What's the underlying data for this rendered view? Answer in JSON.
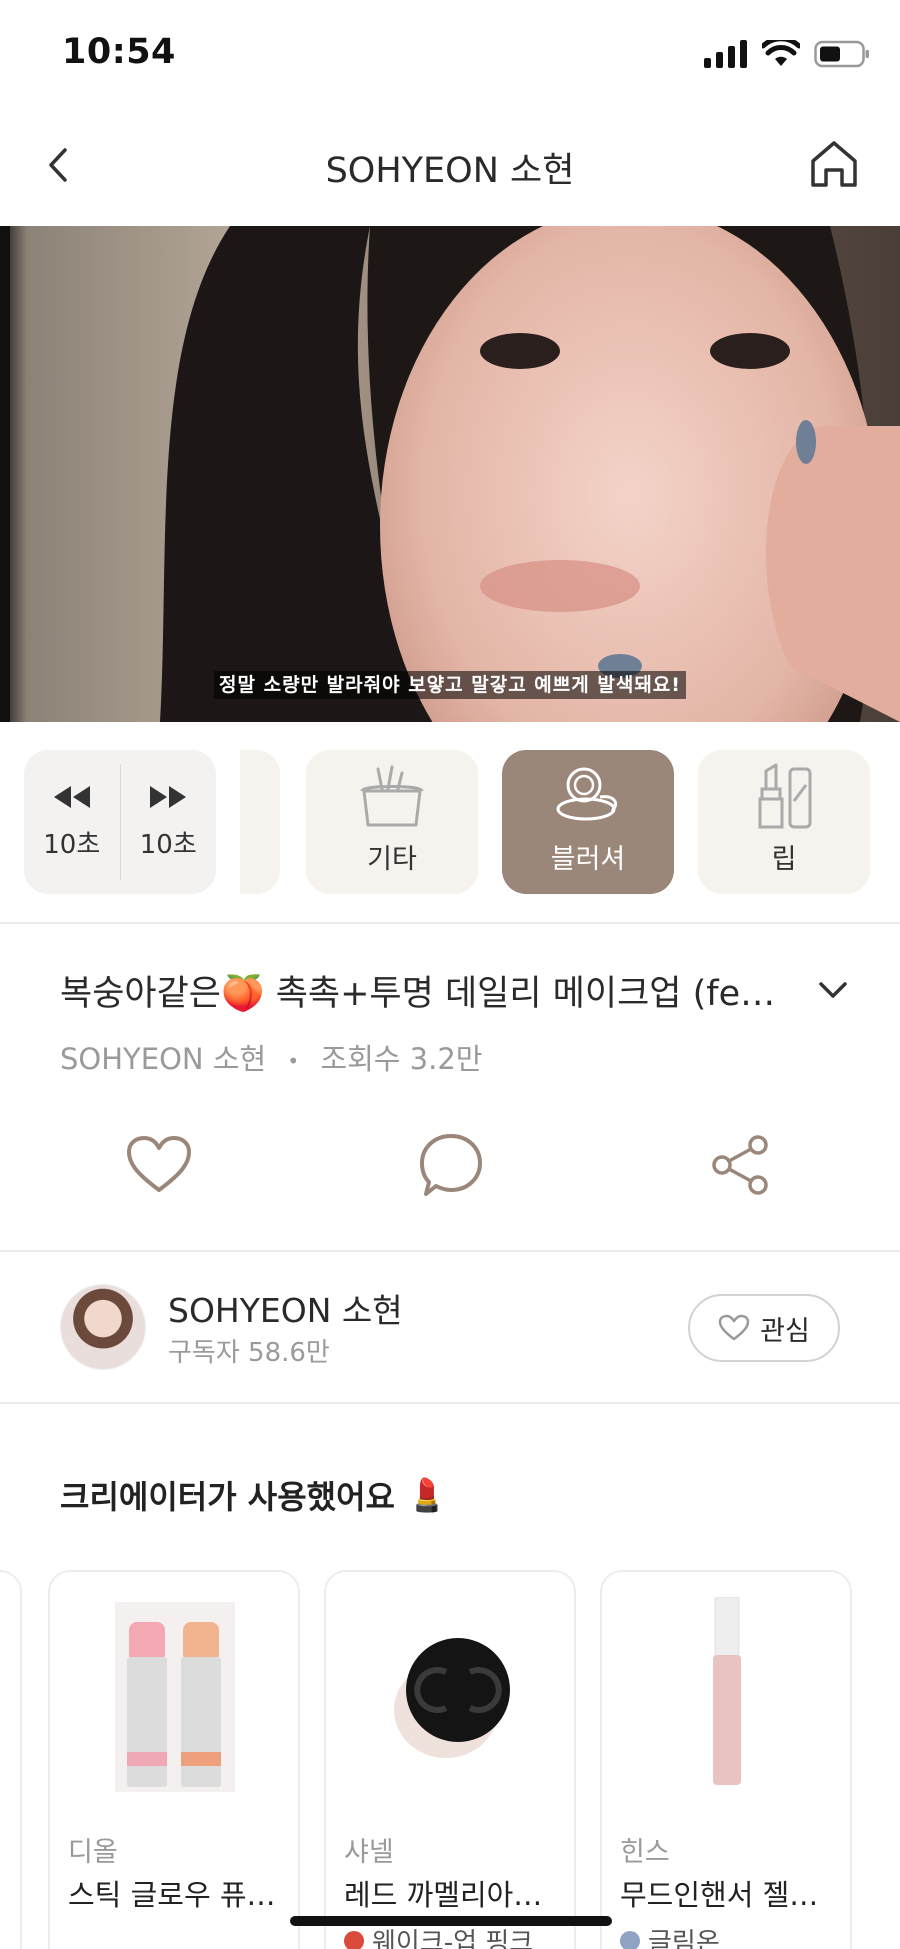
{
  "status": {
    "time": "10:54"
  },
  "nav": {
    "title": "SOHYEON 소현"
  },
  "video": {
    "caption": "정말 소량만 발라줘야 보얗고 말갛고 예쁘게 발색돼요!"
  },
  "controls": {
    "rewind_label": "10초",
    "forward_label": "10초",
    "categories": [
      {
        "label": "기타",
        "icon": "pouch-icon",
        "active": false
      },
      {
        "label": "블러셔",
        "icon": "compact-icon",
        "active": true
      },
      {
        "label": "립",
        "icon": "lipstick-icon",
        "active": false
      }
    ],
    "active_color": "#9a877a",
    "inactive_color": "#f6f2ed"
  },
  "info": {
    "title": "복숭아같은🍑 촉촉+투명 데일리 메이크업 (fe…",
    "channel": "SOHYEON 소현",
    "separator": "•",
    "views": "조회수 3.2만"
  },
  "creator": {
    "name": "SOHYEON 소현",
    "subscribers": "구독자 58.6만",
    "follow_label": "관심"
  },
  "products_section": {
    "title": "크리에이터가 사용했어요",
    "emoji": "💄",
    "items": [
      {
        "brand": "디올",
        "name": "스틱 글로우 퓨…",
        "shade": "",
        "shade_color": ""
      },
      {
        "brand": "샤넬",
        "name": "레드 까멜리아…",
        "shade": "웨이크-업 핑크",
        "shade_color": "#d94a3a"
      },
      {
        "brand": "힌스",
        "name": "무드인핸서 젤…",
        "shade": "글림온",
        "shade_color": "#8fa3c4"
      }
    ]
  }
}
